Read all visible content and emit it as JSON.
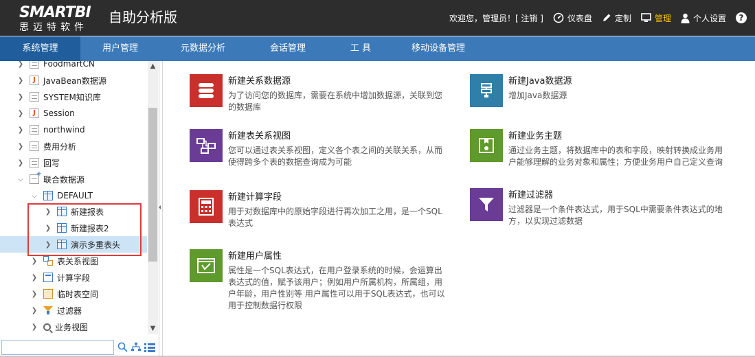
{
  "header": {
    "logo_text": "SMARTBI",
    "logo_sub": "思迈特软件",
    "app_title": "自助分析版",
    "welcome": "欢迎您，管理员！[ 注销 ]",
    "items": [
      {
        "label": "仪表盘",
        "icon": "dashboard-icon"
      },
      {
        "label": "定制",
        "icon": "pencil-icon"
      },
      {
        "label": "管理",
        "icon": "monitor-icon",
        "active": true
      },
      {
        "label": "个人设置",
        "icon": "user-icon"
      }
    ],
    "help": "?"
  },
  "nav": {
    "tabs": [
      {
        "label": "系统管理",
        "active": true
      },
      {
        "label": "用户管理"
      },
      {
        "label": "元数据分析"
      },
      {
        "label": "会话管理"
      },
      {
        "label": "工 具"
      },
      {
        "label": "移动设备管理"
      }
    ]
  },
  "tree": {
    "items": [
      {
        "label": "FoodmartCN",
        "icon": "doc-icon"
      },
      {
        "label": "JavaBean数据源",
        "icon": "javabean-icon"
      },
      {
        "label": "SYSTEM知识库",
        "icon": "doc-icon"
      },
      {
        "label": "Session",
        "icon": "javabean-icon"
      },
      {
        "label": "northwind",
        "icon": "doc-icon"
      },
      {
        "label": "费用分析",
        "icon": "doc-icon"
      },
      {
        "label": "回写",
        "icon": "doc-icon"
      },
      {
        "label": "联合数据源",
        "icon": "union-datasource-icon"
      },
      {
        "label": "DEFAULT",
        "icon": "database-icon"
      },
      {
        "label": "新建报表",
        "icon": "table-icon"
      },
      {
        "label": "新建报表2",
        "icon": "table-icon"
      },
      {
        "label": "演示多重表头",
        "icon": "table-icon"
      },
      {
        "label": "表关系视图",
        "icon": "relation-icon"
      },
      {
        "label": "计算字段",
        "icon": "calc-icon"
      },
      {
        "label": "临时表空间",
        "icon": "temp-space-icon"
      },
      {
        "label": "过滤器",
        "icon": "filter-icon"
      },
      {
        "label": "业务视图",
        "icon": "search-icon"
      }
    ]
  },
  "main": {
    "cards": [
      {
        "title": "新建关系数据源",
        "desc": "为了访问您的数据库，需要在系统中增加数据源，关联到您的数据库",
        "color": "#c9302c"
      },
      {
        "title": "新建Java数据源",
        "desc": "增加Java数据源",
        "color": "#2f7fa8"
      },
      {
        "title": "新建表关系视图",
        "desc": "您可以通过表关系视图，定义各个表之间的关联关系，从而使得跨多个表的数据查询成为可能",
        "color": "#6a3c96"
      },
      {
        "title": "新建业务主题",
        "desc": "通过业务主题，将数据库中的表和字段，映射转换成业务用户能够理解的业务对象和属性；方便业务用户自己定义查询",
        "color": "#5e9a2c"
      },
      {
        "title": "新建计算字段",
        "desc": "用于对数据库中的原始字段进行再次加工之用，是一个SQL表达式",
        "color": "#c9302c"
      },
      {
        "title": "新建过滤器",
        "desc": "过滤器是一个条件表达式，用于SQL中需要条件表达式的地方，以实现过滤数据",
        "color": "#6a3c96"
      },
      {
        "title": "新建用户属性",
        "desc": "属性是一个SQL表达式，在用户登录系统的时候，会运算出表达式的值，赋予该用户；例如用户所属机构，所属组，用户年龄，用户性别等 用户属性可以用于SQL表达式，也可以用于控制数据行权限",
        "color": "#5e9a2c"
      }
    ]
  },
  "colors": {
    "header_bg": "#2d2d2d",
    "nav_bg": "#3c79b8",
    "nav_active": "#1f5d9c",
    "selected_row": "#cde4f7",
    "highlight_border": "#e03b3b"
  }
}
